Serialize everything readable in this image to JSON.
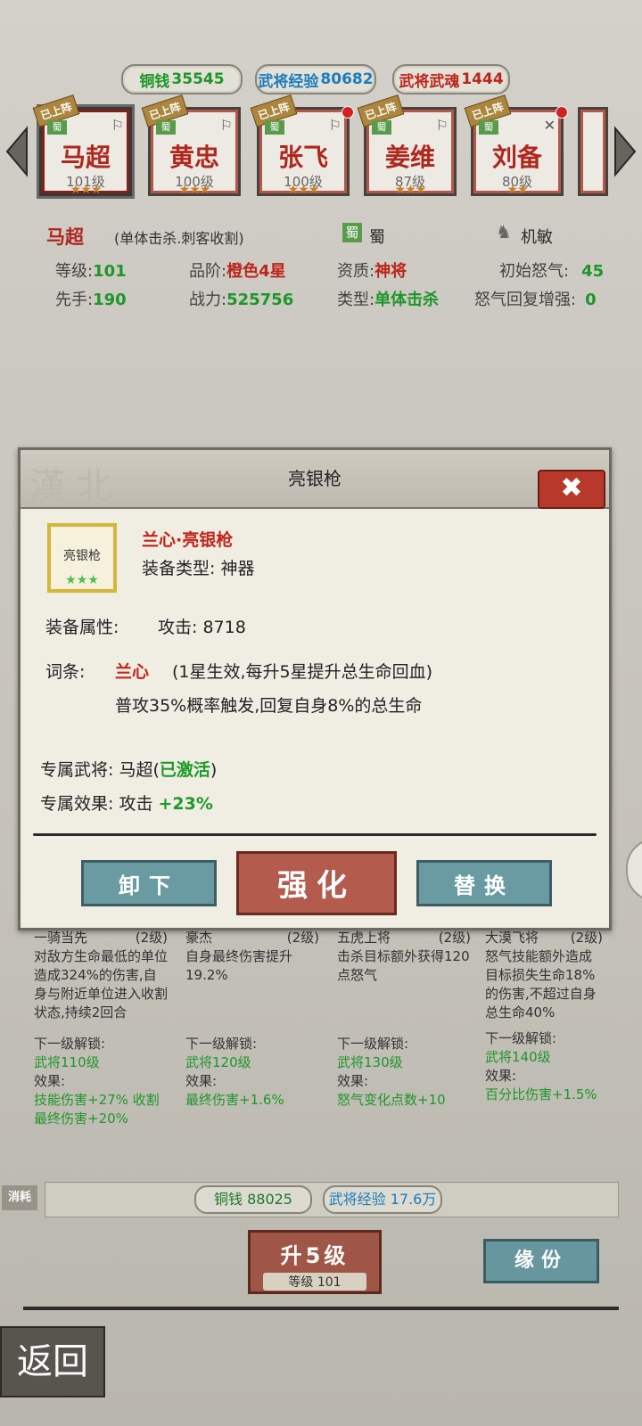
{
  "currency": {
    "copper": {
      "label": "铜钱",
      "value": "35545"
    },
    "exp": {
      "label": "武将经验",
      "value": "80682"
    },
    "soul": {
      "label": "武将武魂",
      "value": "1444"
    }
  },
  "heroes": [
    {
      "name": "马超",
      "level": "101级",
      "stars": "★★★",
      "faction": "蜀",
      "tag": "已上阵",
      "dot": false
    },
    {
      "name": "黄忠",
      "level": "100级",
      "stars": "★★★",
      "faction": "蜀",
      "tag": "已上阵",
      "dot": false
    },
    {
      "name": "张飞",
      "level": "100级",
      "stars": "★★★",
      "faction": "蜀",
      "tag": "已上阵",
      "dot": true
    },
    {
      "name": "姜维",
      "level": "87级",
      "stars": "★★★",
      "faction": "蜀",
      "tag": "已上阵",
      "dot": false
    },
    {
      "name": "刘备",
      "level": "80级",
      "stars": "★★",
      "faction": "蜀",
      "tag": "已上阵",
      "dot": true
    }
  ],
  "hero_info": {
    "name": "马超",
    "desc": "(单体击杀.刺客收割)",
    "faction": "蜀",
    "trait": "机敏",
    "level_label": "等级:",
    "level": "101",
    "grade_label": "品阶:",
    "grade": "橙色4星",
    "quality_label": "资质:",
    "quality": "神将",
    "rage_label": "初始怒气:",
    "rage": "45",
    "speed_label": "先手:",
    "speed": "190",
    "power_label": "战力:",
    "power": "525756",
    "type_label": "类型:",
    "type": "单体击杀",
    "rage_regen_label": "怒气回复增强:",
    "rage_regen": "0"
  },
  "modal": {
    "title": "亮银枪",
    "icon_name": "亮银枪",
    "icon_stars": "★★★",
    "item_name": "兰心·亮银枪",
    "type": "装备类型: 神器",
    "attr_label": "装备属性:",
    "attr_value": "攻击: 8718",
    "entry_label": "词条:",
    "entry_name": "兰心",
    "entry_cond": "(1星生效,每升5星提升总生命回血)",
    "entry_desc": "普攻35%概率触发,回复自身8%的总生命",
    "exclusive_label": "专属武将: 马超(",
    "exclusive_status": "已激活",
    "exclusive_close": ")",
    "effect_label": "专属效果: 攻击",
    "effect_value": "+23%",
    "btn_unequip": "卸下",
    "btn_enhance": "强化",
    "btn_replace": "替换"
  },
  "skills": [
    {
      "name": "一骑当先",
      "lv": "(2级)",
      "desc": "对敌方生命最低的单位造成324%的伤害,自身与附近单位进入收割状态,持续2回合",
      "next": "下一级解锁:",
      "req": "武将110级",
      "eff_label": "效果:",
      "eff": "技能伤害+27% 收割最终伤害+20%"
    },
    {
      "name": "豪杰",
      "lv": "(2级)",
      "desc": "自身最终伤害提升19.2%",
      "next": "下一级解锁:",
      "req": "武将120级",
      "eff_label": "效果:",
      "eff": "最终伤害+1.6%"
    },
    {
      "name": "五虎上将",
      "lv": "(2级)",
      "desc": "击杀目标额外获得120点怒气",
      "next": "下一级解锁:",
      "req": "武将130级",
      "eff_label": "效果:",
      "eff": "怒气变化点数+10"
    },
    {
      "name": "大漠飞将",
      "lv": "(2级)",
      "desc": "怒气技能额外造成目标损失生命18%的伤害,不超过自身总生命40%",
      "next": "下一级解锁:",
      "req": "武将140级",
      "eff_label": "效果:",
      "eff": "百分比伤害+1.5%"
    }
  ],
  "cost": {
    "label": "消耗",
    "copper": "铜钱 88025",
    "exp": "武将经验 17.6万"
  },
  "upgrade": {
    "label": "升5级",
    "sub": "等级 101"
  },
  "bond": "缘份",
  "back": "返回"
}
